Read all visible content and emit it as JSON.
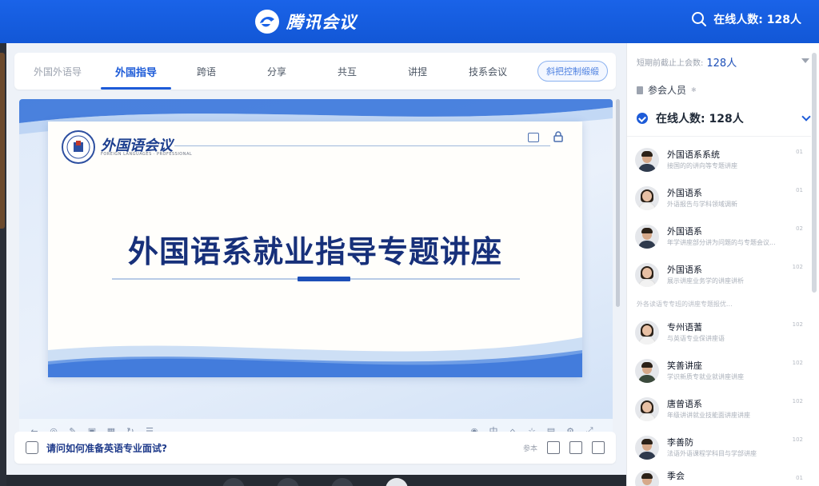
{
  "app": {
    "title": "腾讯会议",
    "online_label": "在线人数: 128人"
  },
  "tabs": [
    {
      "label": "外国外语导",
      "faded": true
    },
    {
      "label": "外国指导",
      "active": true
    },
    {
      "label": "跨语"
    },
    {
      "label": "分享"
    },
    {
      "label": "共互"
    },
    {
      "label": "讲捏"
    },
    {
      "label": "技系会议"
    }
  ],
  "tab_button": "斜把控制缎缎",
  "slide": {
    "brand": "外国语会议",
    "brand_sub": "FOREIGN LANGUAGES · PROFESSIONAL",
    "title": "外国语系就业指导专题讲座"
  },
  "question": {
    "text": "请问如何准备英语专业面试?",
    "tools_label": "参本"
  },
  "sidebar": {
    "row1_label": "短期前截止上会数:",
    "row1_value": "128人",
    "attendees_label": "参会人员",
    "online_label": "在线人数: 128人",
    "separator": "外各读语专专班的讲座专题报优...",
    "participants": [
      {
        "name": "外国语系系统",
        "sub": "接国的的讲向等专题讲座",
        "tag": "01",
        "gender": "m"
      },
      {
        "name": "外国语系",
        "sub": "外语报告与学科领域调新",
        "tag": "01",
        "gender": "f"
      },
      {
        "name": "外国语系",
        "sub": "年学讲座部分讲为问题的与专题会议...",
        "tag": "02",
        "gender": "m"
      },
      {
        "name": "外国语系",
        "sub": "展示讲座业务学的讲座讲析",
        "tag": "102",
        "gender": "f"
      },
      {
        "name": "专州语蓍",
        "sub": "与英语专业保讲座语",
        "tag": "102",
        "gender": "f"
      },
      {
        "name": "笑善讲座",
        "sub": "学识新质专就业就讲座讲座",
        "tag": "102",
        "gender": "m"
      },
      {
        "name": "唐曾语系",
        "sub": "年级讲讲就业技能面讲座讲座",
        "tag": "102",
        "gender": "f"
      },
      {
        "name": "李善防",
        "sub": "法语外语课程学科目与学部讲座",
        "tag": "102",
        "gender": "m"
      },
      {
        "name": "季会",
        "sub": "",
        "tag": "01",
        "gender": "m"
      }
    ]
  }
}
